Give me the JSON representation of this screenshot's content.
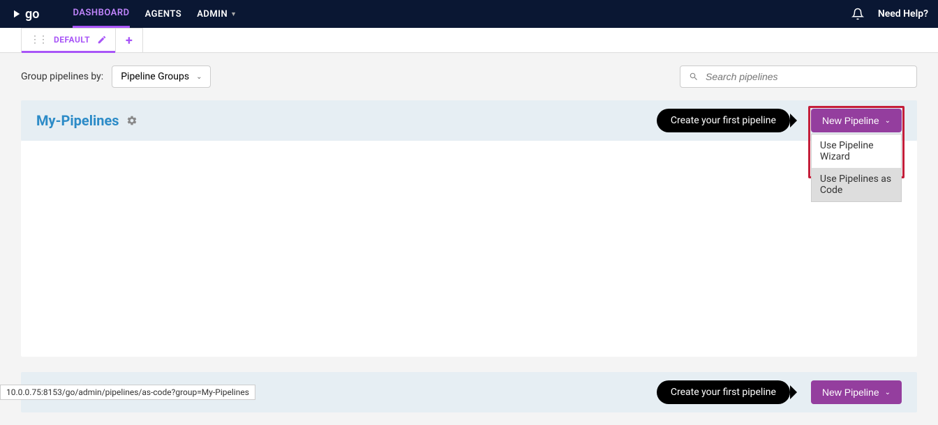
{
  "nav": {
    "logo_text": "go",
    "links": [
      "DASHBOARD",
      "AGENTS",
      "ADMIN"
    ],
    "help": "Need Help?"
  },
  "tabs": {
    "default_label": "DEFAULT"
  },
  "controls": {
    "group_by_label": "Group pipelines by:",
    "group_by_value": "Pipeline Groups",
    "search_placeholder": "Search pipelines"
  },
  "group": {
    "title": "My-Pipelines",
    "tooltip": "Create your first pipeline",
    "new_btn": "New Pipeline",
    "menu": {
      "wizard": "Use Pipeline Wizard",
      "as_code": "Use Pipelines as Code"
    }
  },
  "second_group": {
    "tooltip": "Create your first pipeline",
    "new_btn": "New Pipeline"
  },
  "status_url": "10.0.0.75:8153/go/admin/pipelines/as-code?group=My-Pipelines"
}
